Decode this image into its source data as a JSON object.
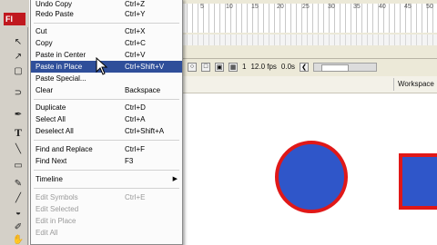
{
  "app": {
    "badge": "Fl"
  },
  "edit_menu": {
    "items": [
      {
        "label": "Undo Copy",
        "shortcut": "Ctrl+Z"
      },
      {
        "label": "Redo Paste",
        "shortcut": "Ctrl+Y"
      },
      {
        "label": "Cut",
        "shortcut": "Ctrl+X"
      },
      {
        "label": "Copy",
        "shortcut": "Ctrl+C"
      },
      {
        "label": "Paste in Center",
        "shortcut": "Ctrl+V"
      },
      {
        "label": "Paste in Place",
        "shortcut": "Ctrl+Shift+V"
      },
      {
        "label": "Paste Special...",
        "shortcut": ""
      },
      {
        "label": "Clear",
        "shortcut": "Backspace"
      },
      {
        "label": "Duplicate",
        "shortcut": "Ctrl+D"
      },
      {
        "label": "Select All",
        "shortcut": "Ctrl+A"
      },
      {
        "label": "Deselect All",
        "shortcut": "Ctrl+Shift+A"
      },
      {
        "label": "Find and Replace",
        "shortcut": "Ctrl+F"
      },
      {
        "label": "Find Next",
        "shortcut": "F3"
      },
      {
        "label": "Timeline",
        "shortcut": ""
      },
      {
        "label": "Edit Symbols",
        "shortcut": "Ctrl+E"
      },
      {
        "label": "Edit Selected",
        "shortcut": ""
      },
      {
        "label": "Edit in Place",
        "shortcut": ""
      },
      {
        "label": "Edit All",
        "shortcut": ""
      }
    ],
    "highlighted": "Paste in Place"
  },
  "timeline": {
    "frame_numbers": [
      "5",
      "10",
      "15",
      "20",
      "25",
      "30",
      "35",
      "40",
      "45",
      "50"
    ],
    "current_frame": "1",
    "fps": "12.0 fps",
    "time": "0.0s"
  },
  "edit_bar": {
    "workspace_label": "Workspace"
  },
  "colors": {
    "menu_highlight": "#2f4f9a",
    "shape_fill": "#2f56c9",
    "shape_stroke": "#e01818"
  },
  "icons": [
    "arrow-tool-icon",
    "subselect-tool-icon",
    "free-transform-icon",
    "lasso-icon",
    "pen-icon",
    "text-tool-icon",
    "line-tool-icon",
    "rectangle-tool-icon",
    "pencil-icon",
    "brush-icon",
    "ink-bottle-icon",
    "paint-bucket-icon",
    "eyedropper-icon",
    "eraser-icon",
    "hand-icon"
  ]
}
